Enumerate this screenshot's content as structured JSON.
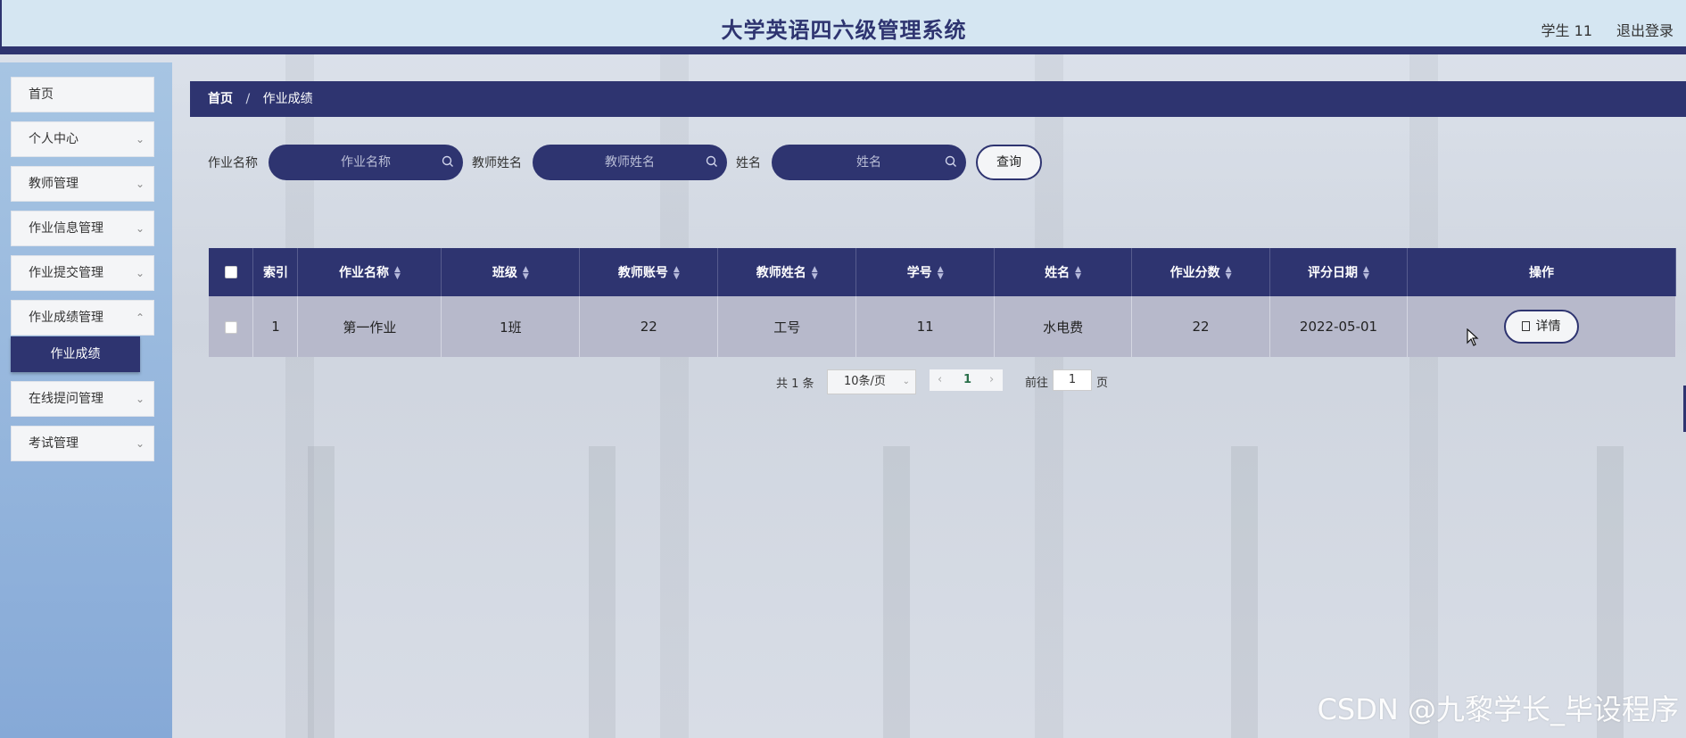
{
  "header": {
    "title": "大学英语四六级管理系统",
    "user": "学生 11",
    "logout": "退出登录"
  },
  "sidebar": {
    "items": [
      {
        "label": "首页",
        "has_chevron": false
      },
      {
        "label": "个人中心",
        "has_chevron": true
      },
      {
        "label": "教师管理",
        "has_chevron": true
      },
      {
        "label": "作业信息管理",
        "has_chevron": true
      },
      {
        "label": "作业提交管理",
        "has_chevron": true
      },
      {
        "label": "作业成绩管理",
        "has_chevron": true
      },
      {
        "label": "在线提问管理",
        "has_chevron": true
      },
      {
        "label": "考试管理",
        "has_chevron": true
      }
    ],
    "active_sub": "作业成绩"
  },
  "breadcrumb": {
    "home": "首页",
    "separator": "/",
    "current": "作业成绩"
  },
  "search": {
    "fields": [
      {
        "label": "作业名称",
        "placeholder": "作业名称"
      },
      {
        "label": "教师姓名",
        "placeholder": "教师姓名"
      },
      {
        "label": "姓名",
        "placeholder": "姓名"
      }
    ],
    "button": "查询"
  },
  "table": {
    "columns": [
      "索引",
      "作业名称",
      "班级",
      "教师账号",
      "教师姓名",
      "学号",
      "姓名",
      "作业分数",
      "评分日期",
      "操作"
    ],
    "rows": [
      {
        "index": "1",
        "name": "第一作业",
        "class": "1班",
        "teacher_account": "22",
        "teacher_name": "工号",
        "student_no": "11",
        "student_name": "水电费",
        "score": "22",
        "date": "2022-05-01",
        "action": "详情"
      }
    ]
  },
  "pagination": {
    "total": "共 1 条",
    "page_size": "10条/页",
    "current_page": "1",
    "goto_label": "前往",
    "goto_value": "1",
    "page_suffix": "页"
  },
  "watermark": "CSDN @九黎学长_毕设程序",
  "colors": {
    "primary": "#2e3470",
    "header_bg": "#d5e6f2",
    "row_bg": "#b7b9cb"
  }
}
